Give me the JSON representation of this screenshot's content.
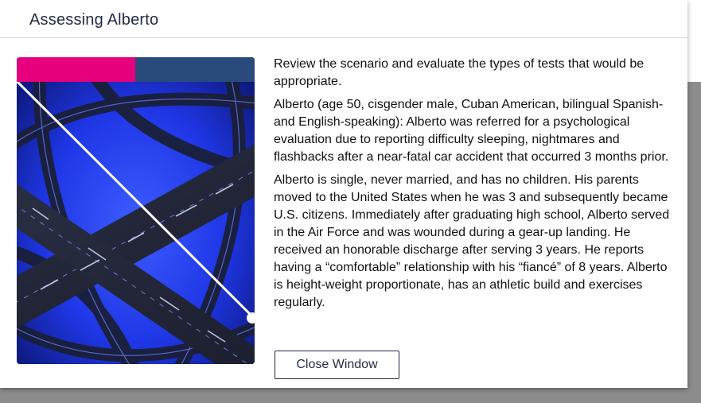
{
  "modal": {
    "title": "Assessing Alberto",
    "paragraphs": [
      "Review the scenario and evaluate the types of tests that would be appropriate.",
      "Alberto (age 50, cisgender male, Cuban American, bilingual Spanish- and English-speaking): Alberto was referred for a psychological evaluation due to reporting difficulty sleeping, nightmares and flashbacks after a near-fatal car accident that occurred 3 months prior.",
      "Alberto is single, never married, and has no children. His parents moved to the United States when he was 3 and subsequently became U.S. citizens. Immediately after graduating high school, Alberto served in the Air Force and was wounded during a gear-up landing. He received an honorable discharge after serving 3 years. He reports having a “comfortable” relationship with his “fiancé” of 8 years. Alberto is height-weight proportionate, has an athletic build and exercises regularly."
    ],
    "close_label": "Close Window"
  },
  "image": {
    "icon": "highway-interchange-image",
    "accent_colors": {
      "pink": "#e6007e",
      "navy": "#2b4a7c",
      "blue": "#1f3cff"
    }
  }
}
